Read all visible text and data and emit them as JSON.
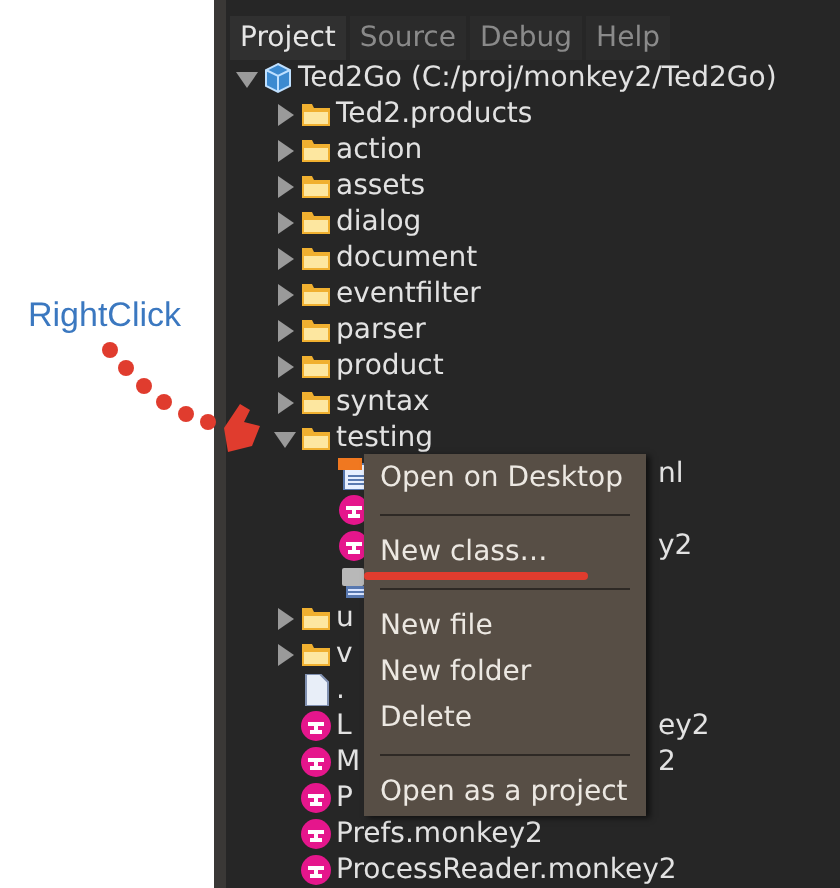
{
  "annotation": {
    "label": "RightClick"
  },
  "tabs": [
    {
      "label": "Project",
      "selected": true
    },
    {
      "label": "Source",
      "selected": false
    },
    {
      "label": "Debug",
      "selected": false
    },
    {
      "label": "Help",
      "selected": false
    }
  ],
  "tree": {
    "kind": "project",
    "label": "Ted2Go (C:/proj/monkey2/Ted2Go)",
    "expanded": true,
    "children": [
      {
        "kind": "folder",
        "label": "Ted2.products",
        "expanded": false
      },
      {
        "kind": "folder",
        "label": "action",
        "expanded": false
      },
      {
        "kind": "folder",
        "label": "assets",
        "expanded": false
      },
      {
        "kind": "folder",
        "label": "dialog",
        "expanded": false
      },
      {
        "kind": "folder",
        "label": "document",
        "expanded": false
      },
      {
        "kind": "folder",
        "label": "eventfilter",
        "expanded": false
      },
      {
        "kind": "folder",
        "label": "parser",
        "expanded": false
      },
      {
        "kind": "folder",
        "label": "product",
        "expanded": false
      },
      {
        "kind": "folder",
        "label": "syntax",
        "expanded": false
      },
      {
        "kind": "folder",
        "label": "testing",
        "expanded": true,
        "children": [
          {
            "kind": "xml",
            "tail": "nl"
          },
          {
            "kind": "monkey"
          },
          {
            "kind": "monkey",
            "tail": "y2"
          },
          {
            "kind": "image"
          }
        ]
      },
      {
        "kind": "folder",
        "label": "u",
        "expanded": false
      },
      {
        "kind": "folder",
        "label": "v",
        "expanded": false
      },
      {
        "kind": "file",
        "label": "."
      },
      {
        "kind": "monkey",
        "label": "L",
        "tail": "ey2"
      },
      {
        "kind": "monkey",
        "label": "M",
        "tail": "2"
      },
      {
        "kind": "monkey",
        "label": "P"
      },
      {
        "kind": "monkey",
        "label": "Prefs.monkey2"
      },
      {
        "kind": "monkey",
        "label": "ProcessReader.monkey2"
      }
    ]
  },
  "context_menu": [
    {
      "kind": "item",
      "label": "Open on Desktop",
      "underlined": false
    },
    {
      "kind": "separator"
    },
    {
      "kind": "item",
      "label": "New class…",
      "underlined": true
    },
    {
      "kind": "separator"
    },
    {
      "kind": "item",
      "label": "New file",
      "underlined": false
    },
    {
      "kind": "item",
      "label": "New folder",
      "underlined": false
    },
    {
      "kind": "item",
      "label": "Delete",
      "underlined": false
    },
    {
      "kind": "separator"
    },
    {
      "kind": "item",
      "label": "Open as a project",
      "underlined": false
    }
  ]
}
